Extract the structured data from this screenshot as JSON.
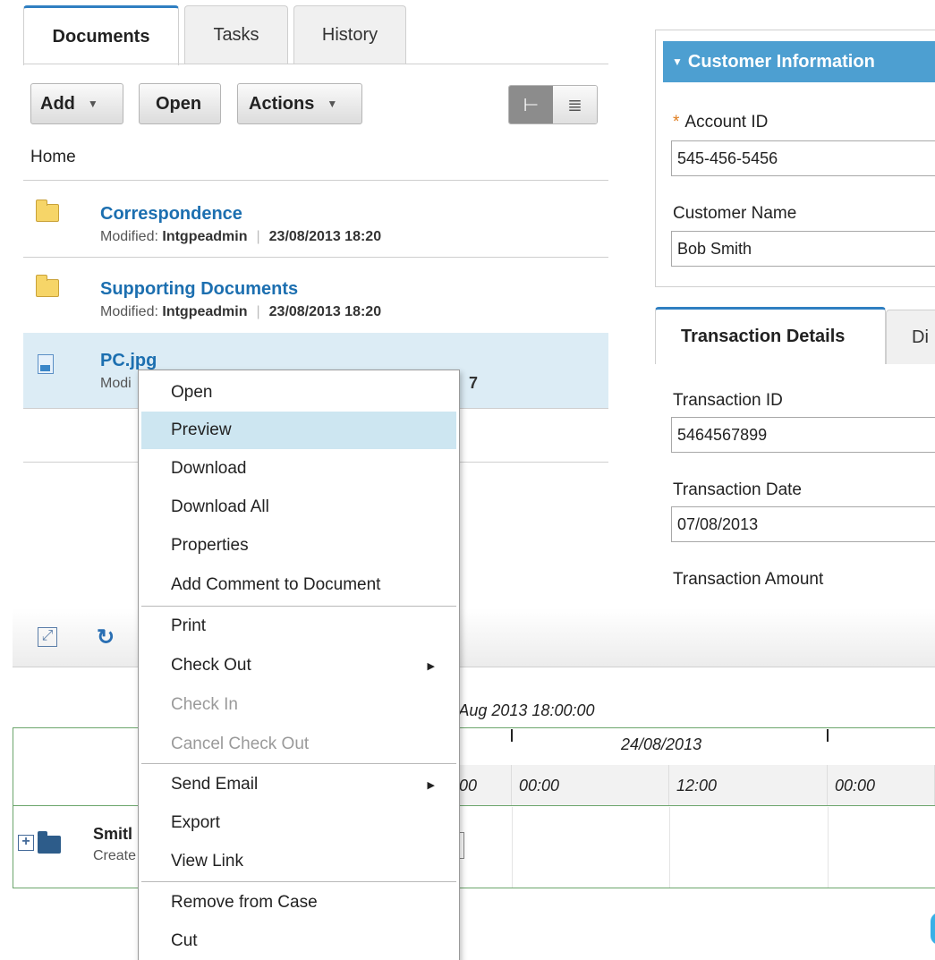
{
  "left_tabs": [
    "Documents",
    "Tasks",
    "History"
  ],
  "toolbar": {
    "add_label": "Add",
    "open_label": "Open",
    "actions_label": "Actions"
  },
  "breadcrumb": "Home",
  "documents": [
    {
      "name": "Correspondence",
      "modified_label": "Modified:",
      "user": "Intgpeadmin",
      "date": "23/08/2013 18:20",
      "icon": "folder-icon"
    },
    {
      "name": "Supporting Documents",
      "modified_label": "Modified:",
      "user": "Intgpeadmin",
      "date": "23/08/2013 18:20",
      "icon": "folder-icon"
    },
    {
      "name": "PC.jpg",
      "modified_label": "Modi",
      "date_fragment": "7",
      "icon": "image-file-icon"
    }
  ],
  "customer_info": {
    "header": "Customer Information",
    "account_id_label": "Account ID",
    "account_id_value": "545-456-5456",
    "customer_name_label": "Customer Name",
    "customer_name_value": "Bob Smith"
  },
  "right_tabs": [
    "Transaction Details",
    "Di"
  ],
  "transaction": {
    "id_label": "Transaction ID",
    "id_value": "5464567899",
    "date_label": "Transaction Date",
    "date_value": "07/08/2013",
    "amount_label": "Transaction Amount"
  },
  "timeline": {
    "timestamp": "3 Aug 2013 18:00:00",
    "date_label": "24/08/2013",
    "hours": [
      ":00",
      "00:00",
      "12:00",
      "00:00"
    ],
    "case_title": "Smitl",
    "case_subtitle": "Create"
  },
  "context_menu": {
    "items": [
      {
        "label": "Open",
        "state": "normal"
      },
      {
        "label": "Preview",
        "state": "highlighted"
      },
      {
        "label": "Download",
        "state": "normal"
      },
      {
        "label": "Download All",
        "state": "normal"
      },
      {
        "label": "Properties",
        "state": "normal"
      },
      {
        "label": "Add Comment to Document",
        "state": "normal"
      },
      {
        "label": "Print",
        "state": "normal"
      },
      {
        "label": "Check Out",
        "state": "normal",
        "submenu": true
      },
      {
        "label": "Check In",
        "state": "disabled"
      },
      {
        "label": "Cancel Check Out",
        "state": "disabled"
      },
      {
        "label": "Send Email",
        "state": "normal",
        "submenu": true
      },
      {
        "label": "Export",
        "state": "normal"
      },
      {
        "label": "View Link",
        "state": "normal"
      },
      {
        "label": "Remove from Case",
        "state": "normal"
      },
      {
        "label": "Cut",
        "state": "normal"
      }
    ]
  },
  "colors": {
    "accent": "#2f7fc1",
    "panel_header": "#4d9fd1",
    "link": "#1c6fb0",
    "selected_row": "#dcecf5",
    "menu_highlight": "#cde6f1",
    "required_marker": "#e07e20",
    "timeline_border": "#6ba56b"
  }
}
